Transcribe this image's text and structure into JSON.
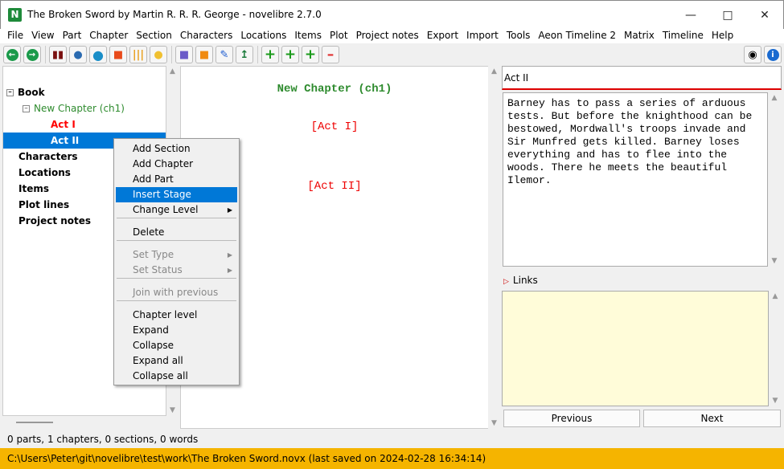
{
  "window": {
    "title": "The Broken Sword by Martin R. R. R. George - novelibre 2.7.0",
    "logo": "N"
  },
  "menu": [
    "File",
    "View",
    "Part",
    "Chapter",
    "Section",
    "Characters",
    "Locations",
    "Items",
    "Plot",
    "Project notes",
    "Export",
    "Import",
    "Tools",
    "Aeon Timeline 2",
    "Matrix",
    "Timeline",
    "Help"
  ],
  "toolbar": [
    "back-icon",
    "forward-icon",
    "book-icon",
    "characters-icon",
    "locations-icon",
    "items-icon",
    "plot-lines-icon",
    "project-notes-icon",
    "save-icon",
    "lock-icon",
    "edit-icon",
    "export-icon",
    "add-icon",
    "add-child-icon",
    "add-parent-icon",
    "delete-icon",
    "view-icon",
    "info-icon"
  ],
  "tree": {
    "book": "Book",
    "chapter": "New Chapter (ch1)",
    "act1": "Act I",
    "act2": "Act II",
    "characters": "Characters",
    "locations": "Locations",
    "items": "Items",
    "plot_lines": "Plot lines",
    "project_notes": "Project notes"
  },
  "editor": {
    "chapter": "New Chapter (ch1)",
    "act1": "[Act I]",
    "act2": "[Act II]"
  },
  "context_menu": [
    "Add Section",
    "Add Chapter",
    "Add Part",
    "Insert Stage",
    "Change Level",
    "Delete",
    "Set Type",
    "Set Status",
    "Join with previous",
    "Chapter level",
    "Expand",
    "Collapse",
    "Expand all",
    "Collapse all"
  ],
  "right": {
    "title": "Act II",
    "description": "Barney has to pass a series of arduous\ntests. But before the knighthood can be\nbestowed, Mordwall's troops invade and\nSir Munfred gets killed. Barney loses\neverything and has to flee into the\nwoods. There he meets the beautiful\nIlemor.",
    "links": "Links",
    "previous": "Previous",
    "next": "Next"
  },
  "status": "0 parts, 1 chapters, 0 sections, 0 words",
  "path": "C:\\Users\\Peter\\git\\novelibre\\test\\work\\The Broken Sword.novx (last saved on 2024-02-28 16:34:14)",
  "colors": {
    "highlight": "#0078d7",
    "chapter": "#2e8b2e",
    "stage": "#ff0000",
    "pathbar": "#f5b400"
  }
}
